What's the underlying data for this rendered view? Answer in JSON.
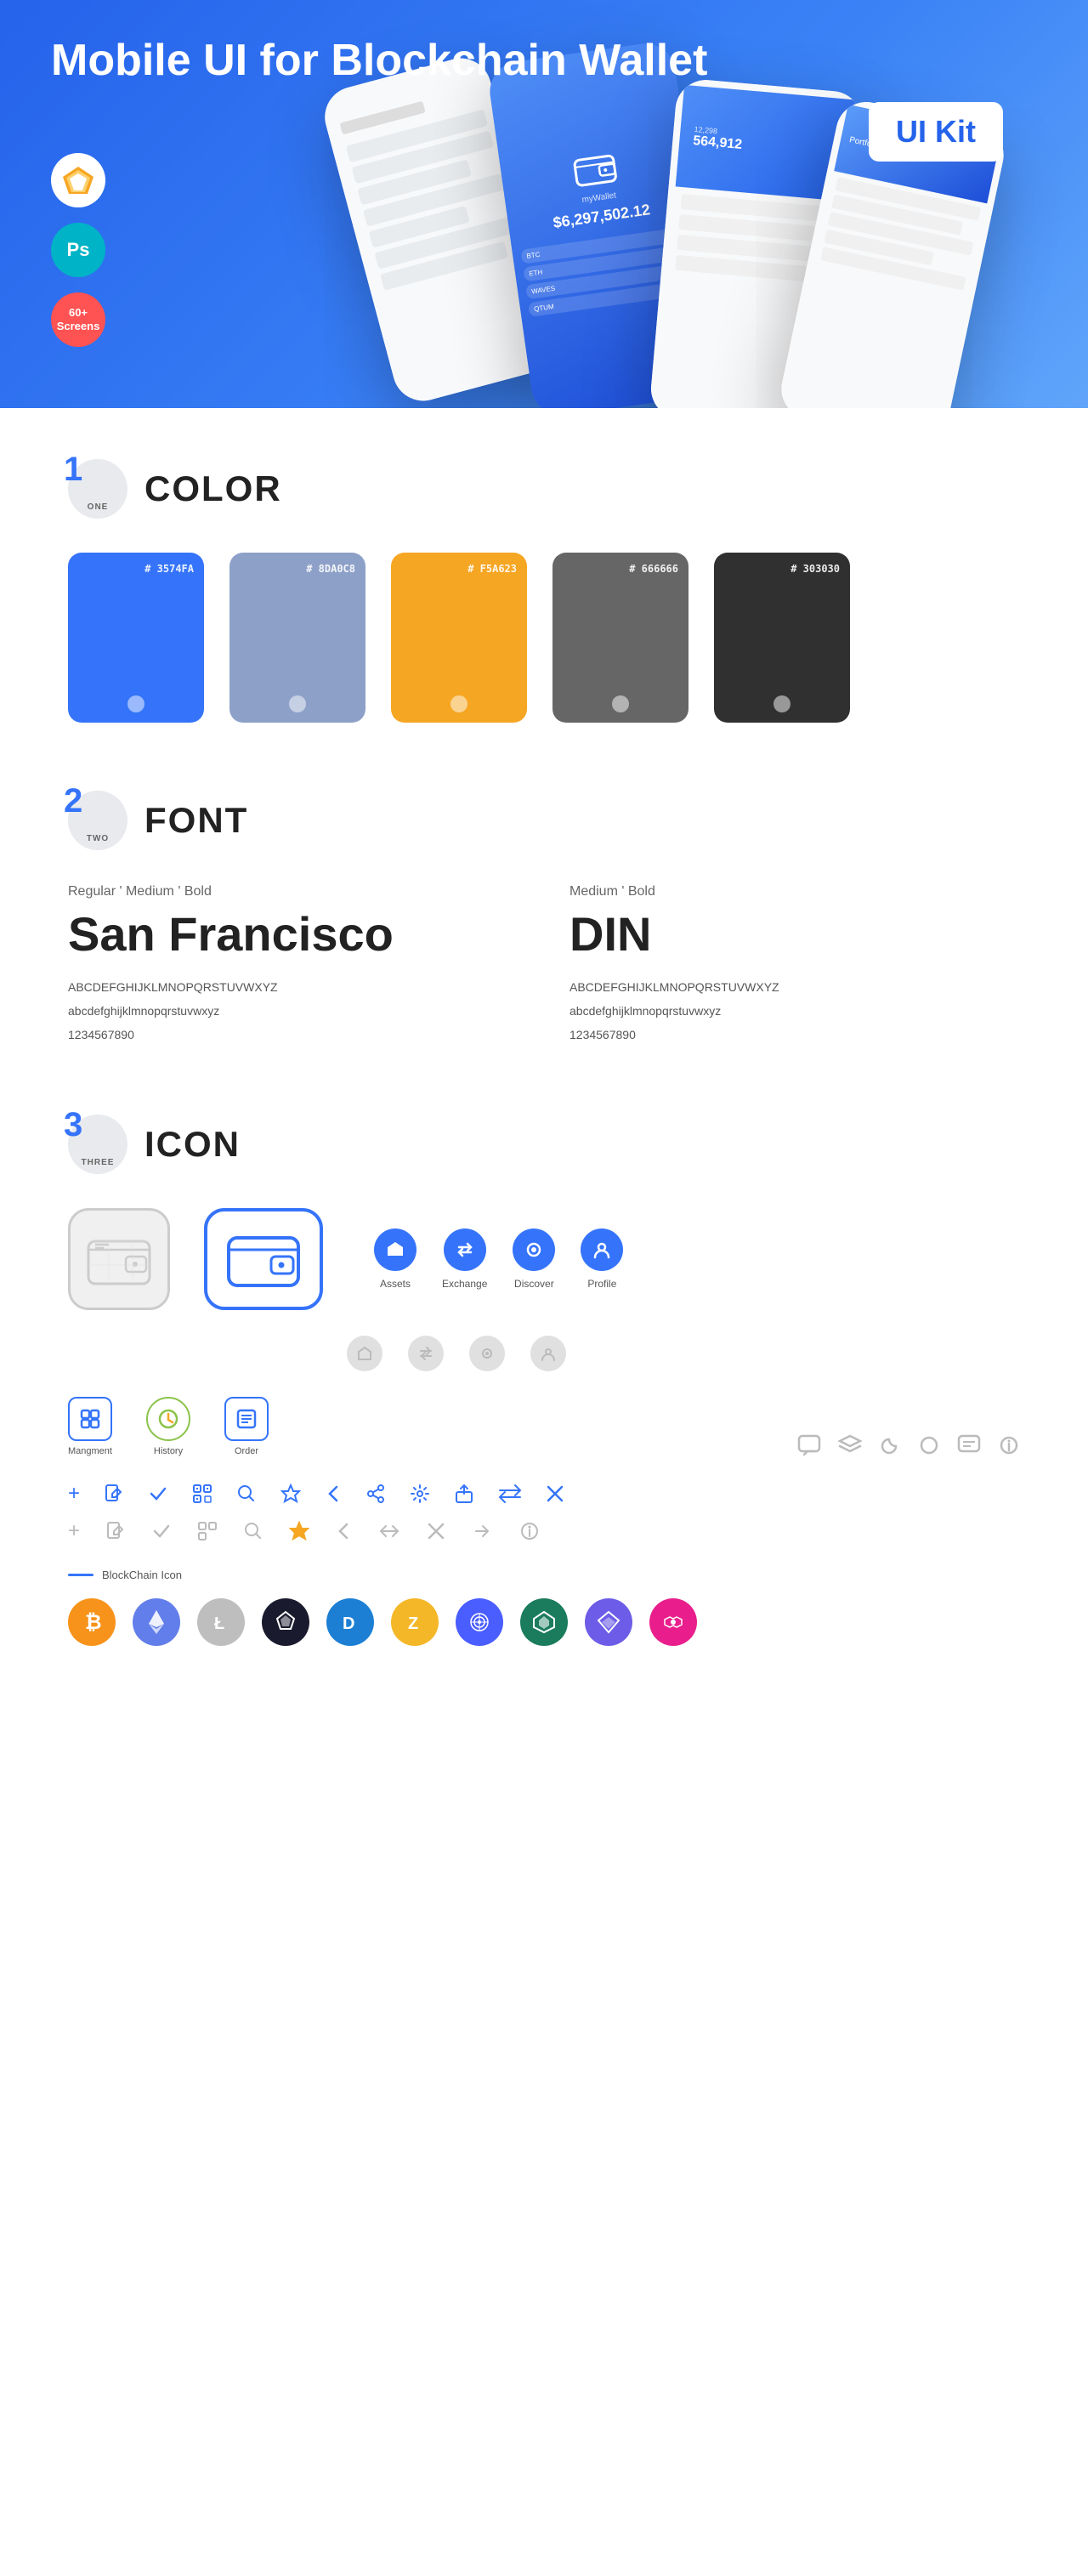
{
  "hero": {
    "title": "Mobile UI for Blockchain ",
    "title_bold": "Wallet",
    "badge": "UI Kit",
    "badges": [
      {
        "label": "Sketch",
        "type": "sketch"
      },
      {
        "label": "Ps",
        "type": "ps"
      },
      {
        "label": "60+\nScreens",
        "type": "screens"
      }
    ]
  },
  "sections": {
    "color": {
      "number": "1",
      "number_label": "ONE",
      "title": "COLOR",
      "swatches": [
        {
          "hex": "#3574FA",
          "display_hex": "# 3574FA"
        },
        {
          "hex": "#8DA0C8",
          "display_hex": "# 8DA0C8"
        },
        {
          "hex": "#F5A623",
          "display_hex": "# F5A623"
        },
        {
          "hex": "#666666",
          "display_hex": "# 666666"
        },
        {
          "hex": "#303030",
          "display_hex": "# 303030"
        }
      ]
    },
    "font": {
      "number": "2",
      "number_label": "TWO",
      "title": "FONT",
      "fonts": [
        {
          "weights": "Regular ' Medium ' Bold",
          "name": "San Francisco",
          "uppercase": "ABCDEFGHIJKLMNOPQRSTUVWXYZ",
          "lowercase": "abcdefghijklmnopqrstuvwxyz",
          "numbers": "1234567890",
          "style": "sf"
        },
        {
          "weights": "Medium ' Bold",
          "name": "DIN",
          "uppercase": "ABCDEFGHIJKLMNOPQRSTUVWXYZ",
          "lowercase": "abcdefghijklmnopqrstuvwxyz",
          "numbers": "1234567890",
          "style": "din"
        }
      ]
    },
    "icon": {
      "number": "3",
      "number_label": "THREE",
      "title": "ICON",
      "nav_icons": [
        {
          "label": "Assets",
          "icon": "◆"
        },
        {
          "label": "Exchange",
          "icon": "⇄"
        },
        {
          "label": "Discover",
          "icon": "●"
        },
        {
          "label": "Profile",
          "icon": "👤"
        }
      ],
      "tab_icons": [
        {
          "label": "Mangment",
          "type": "box"
        },
        {
          "label": "History",
          "type": "clock"
        },
        {
          "label": "Order",
          "type": "list"
        }
      ],
      "blockchain_label": "BlockChain Icon",
      "crypto_coins": [
        {
          "symbol": "₿",
          "color": "#f7931a",
          "name": "Bitcoin"
        },
        {
          "symbol": "Ξ",
          "color": "#627eea",
          "name": "Ethereum"
        },
        {
          "symbol": "Ł",
          "color": "#b5b5b5",
          "name": "Litecoin"
        },
        {
          "symbol": "◈",
          "color": "#1a1a2e",
          "name": "Stratis"
        },
        {
          "symbol": "D",
          "color": "#006db5",
          "name": "Dash"
        },
        {
          "symbol": "Z",
          "color": "#f4b728",
          "name": "Zcash"
        },
        {
          "symbol": "◉",
          "color": "#3d5afe",
          "name": "Monero"
        },
        {
          "symbol": "▲",
          "color": "#27a17b",
          "name": "NEM"
        },
        {
          "symbol": "◇",
          "color": "#6851ff",
          "name": "Vertcoin"
        },
        {
          "symbol": "◈",
          "color": "#e91e8c",
          "name": "Polygon"
        }
      ]
    }
  }
}
